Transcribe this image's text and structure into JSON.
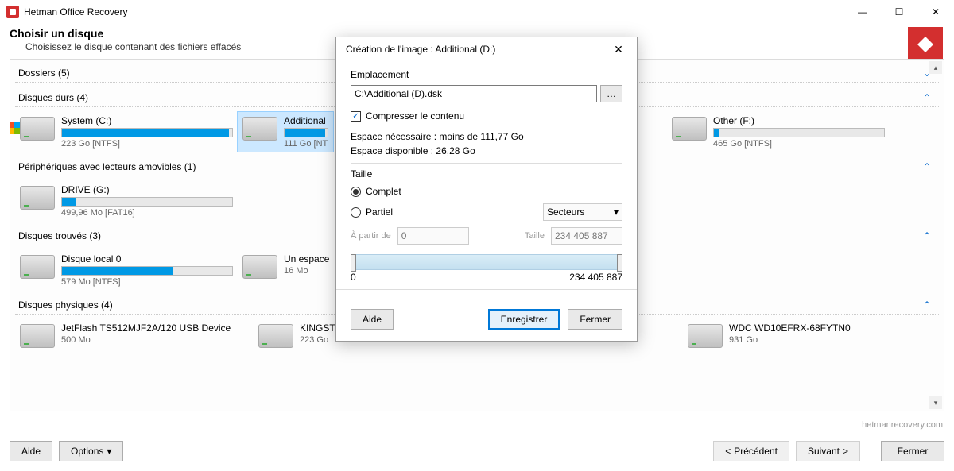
{
  "app_title": "Hetman Office Recovery",
  "header": {
    "title": "Choisir un disque",
    "subtitle": "Choisissez le disque contenant des fichiers effacés"
  },
  "sections": {
    "folders": "Dossiers (5)",
    "hdd": "Disques durs (4)",
    "removable": "Périphériques avec lecteurs amovibles (1)",
    "found": "Disques trouvés (3)",
    "physical": "Disques physiques (4)"
  },
  "hdd": [
    {
      "name": "System (C:)",
      "meta": "223 Go [NTFS]",
      "fill": 98,
      "win": true,
      "sel": false
    },
    {
      "name": "Additional",
      "meta": "111 Go [NT",
      "fill": 95,
      "win": false,
      "sel": true
    },
    {
      "name": "Other (F:)",
      "meta": "465 Go [NTFS]",
      "fill": 3,
      "win": false,
      "sel": false
    }
  ],
  "removable": [
    {
      "name": "DRIVE (G:)",
      "meta": "499,96 Mo [FAT16]",
      "fill": 8
    }
  ],
  "found": [
    {
      "name": "Disque local 0",
      "meta": "579 Mo [NTFS]",
      "fill": 65
    },
    {
      "name": "Un espace",
      "meta": "16 Mo",
      "fill": 0,
      "nobar": true
    }
  ],
  "physical": [
    {
      "name": "JetFlash TS512MJF2A/120 USB Device",
      "meta": "500 Mo"
    },
    {
      "name": "KINGSTON",
      "meta": "223 Go"
    },
    {
      "name": "WDC WD10EFRX-68FYTN0",
      "meta": "931 Go"
    }
  ],
  "footer": {
    "help": "Aide",
    "options": "Options",
    "prev": "Précédent",
    "next": "Suivant",
    "close": "Fermer",
    "brand": "hetmanrecovery.com"
  },
  "dialog": {
    "title": "Création de l'image : Additional (D:)",
    "loc_label": "Emplacement",
    "path": "C:\\Additional (D).dsk",
    "compress": "Compresser le contenu",
    "space_needed": "Espace nécessaire : moins de 111,77 Go",
    "space_avail": "Espace disponible : 26,28 Go",
    "size_label": "Taille",
    "full": "Complet",
    "partial": "Partiel",
    "sectors": "Secteurs",
    "from_lbl": "À partir de",
    "from_val": "0",
    "size_lbl": "Taille",
    "size_val": "234 405 887",
    "slider_min": "0",
    "slider_max": "234 405 887",
    "help": "Aide",
    "save": "Enregistrer",
    "close": "Fermer"
  }
}
